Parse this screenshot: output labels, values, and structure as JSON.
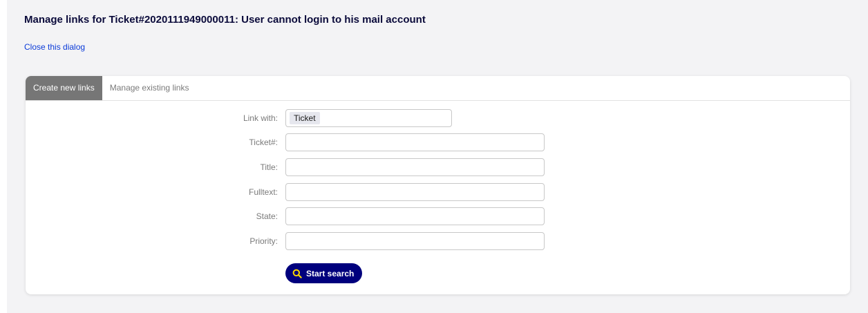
{
  "dialog": {
    "title": "Manage links for Ticket#2020111949000011: User cannot login to his mail account",
    "close_link": "Close this dialog"
  },
  "tabs": [
    {
      "label": "Create new links",
      "active": true
    },
    {
      "label": "Manage existing links",
      "active": false
    }
  ],
  "form": {
    "link_with": {
      "label": "Link with:",
      "value": "Ticket"
    },
    "ticket_number": {
      "label": "Ticket#:",
      "value": ""
    },
    "title": {
      "label": "Title:",
      "value": ""
    },
    "fulltext": {
      "label": "Fulltext:",
      "value": ""
    },
    "state": {
      "label": "State:",
      "value": ""
    },
    "priority": {
      "label": "Priority:",
      "value": ""
    },
    "search_button": {
      "label": "Start search",
      "icon": "search-icon"
    }
  },
  "colors": {
    "background": "#f3f3f5",
    "title_text": "#0b0b3b",
    "link": "#0a3ad8",
    "active_tab": "#767676",
    "primary_button": "#00007d",
    "button_icon": "#ffd800"
  }
}
